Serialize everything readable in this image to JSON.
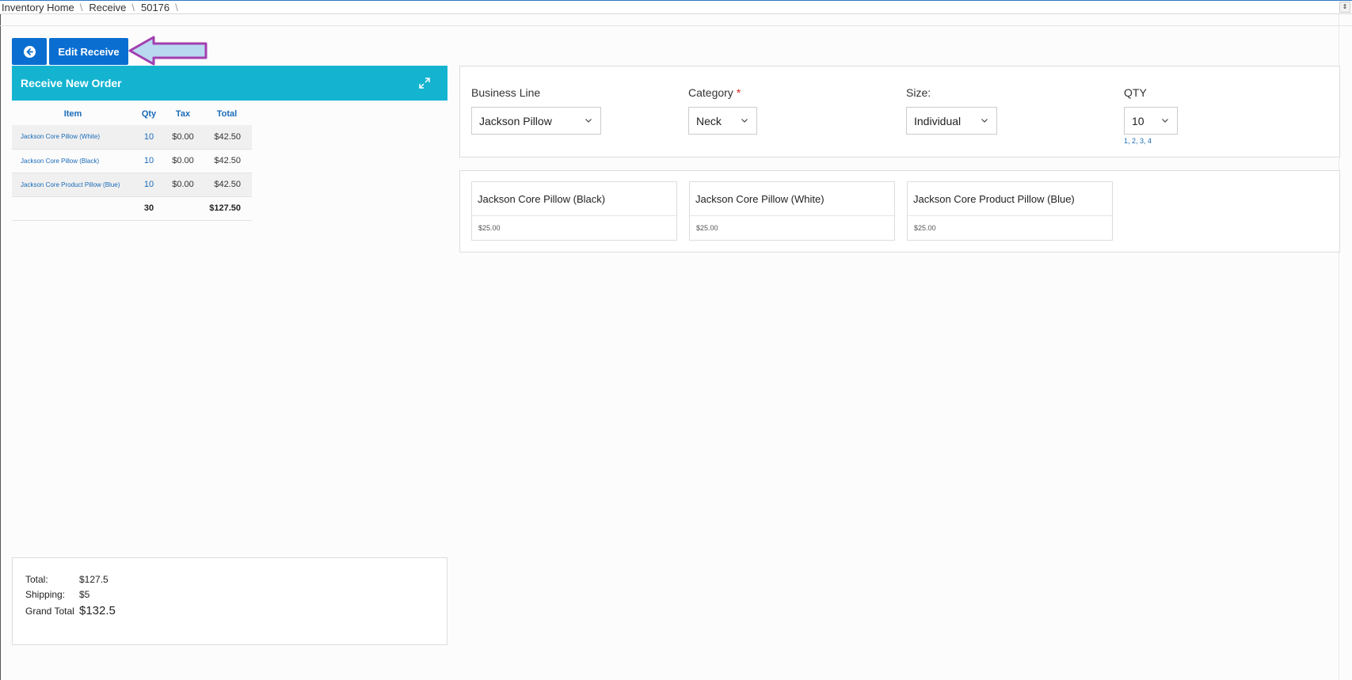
{
  "breadcrumb": [
    "Inventory Home",
    "Receive",
    "50176"
  ],
  "toolbar": {
    "edit_label": "Edit Receive"
  },
  "order_panel": {
    "title": "Receive New Order",
    "columns": {
      "item": "Item",
      "qty": "Qty",
      "tax": "Tax",
      "total": "Total"
    },
    "rows": [
      {
        "item": "Jackson Core Pillow (White)",
        "qty": "10",
        "tax": "$0.00",
        "total": "$42.50"
      },
      {
        "item": "Jackson Core Pillow (Black)",
        "qty": "10",
        "tax": "$0.00",
        "total": "$42.50"
      },
      {
        "item": "Jackson Core Product Pillow (Blue)",
        "qty": "10",
        "tax": "$0.00",
        "total": "$42.50"
      }
    ],
    "sum": {
      "qty": "30",
      "total": "$127.50"
    }
  },
  "summary": {
    "total_label": "Total:",
    "total_value": "$127.5",
    "shipping_label": "Shipping:",
    "shipping_value": "$5",
    "grand_label": "Grand Total",
    "grand_value": "$132.5"
  },
  "filters": {
    "business_line": {
      "label": "Business Line",
      "value": "Jackson Pillow"
    },
    "category": {
      "label": "Category",
      "required_mark": "*",
      "value": "Neck"
    },
    "size": {
      "label": "Size:",
      "value": "Individual"
    },
    "qty": {
      "label": "QTY",
      "value": "10",
      "hint": "1, 2, 3, 4"
    }
  },
  "products": [
    {
      "name": "Jackson Core Pillow (Black)",
      "price": "$25.00"
    },
    {
      "name": "Jackson Core Pillow (White)",
      "price": "$25.00"
    },
    {
      "name": "Jackson Core Product Pillow (Blue)",
      "price": "$25.00"
    }
  ],
  "colors": {
    "primary": "#0a6ed1",
    "header": "#14b4d1",
    "link": "#1a6bb8",
    "annotation_arrow": "#a23fb0"
  },
  "icons": [
    "back-arrow-icon",
    "expand-icon",
    "chevron-down-icon",
    "scroll-up-down-icon"
  ]
}
